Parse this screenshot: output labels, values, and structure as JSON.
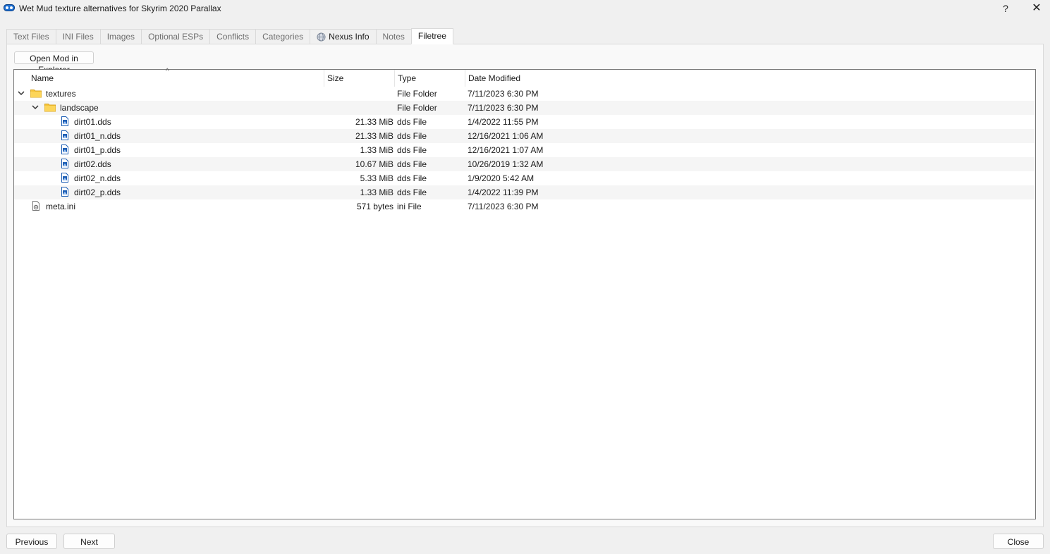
{
  "window": {
    "title": "Wet Mud texture alternatives for Skyrim 2020 Parallax",
    "help_label": "?",
    "close_label": "✕"
  },
  "tabs": [
    {
      "label": "Text Files",
      "active": false
    },
    {
      "label": "INI Files",
      "active": false
    },
    {
      "label": "Images",
      "active": false
    },
    {
      "label": "Optional ESPs",
      "active": false
    },
    {
      "label": "Conflicts",
      "active": false
    },
    {
      "label": "Categories",
      "active": false
    },
    {
      "label": "Nexus Info",
      "active": false,
      "icon": "globe-icon"
    },
    {
      "label": "Notes",
      "active": false
    },
    {
      "label": "Filetree",
      "active": true
    }
  ],
  "toolbar": {
    "open_mod_label": "Open Mod in Explorer"
  },
  "tree": {
    "columns": [
      "Name",
      "Size",
      "Type",
      "Date Modified"
    ],
    "sort_indicator": "^",
    "rows": [
      {
        "name": "textures",
        "size": "",
        "type": "File Folder",
        "date": "7/11/2023 6:30 PM",
        "icon": "folder-icon",
        "expanded": true
      },
      {
        "name": "landscape",
        "size": "",
        "type": "File Folder",
        "date": "7/11/2023 6:30 PM",
        "icon": "folder-icon",
        "expanded": true
      },
      {
        "name": "dirt01.dds",
        "size": "21.33 MiB",
        "type": "dds File",
        "date": "1/4/2022 11:55 PM",
        "icon": "image-file-icon"
      },
      {
        "name": "dirt01_n.dds",
        "size": "21.33 MiB",
        "type": "dds File",
        "date": "12/16/2021 1:06 AM",
        "icon": "image-file-icon"
      },
      {
        "name": "dirt01_p.dds",
        "size": "1.33 MiB",
        "type": "dds File",
        "date": "12/16/2021 1:07 AM",
        "icon": "image-file-icon"
      },
      {
        "name": "dirt02.dds",
        "size": "10.67 MiB",
        "type": "dds File",
        "date": "10/26/2019 1:32 AM",
        "icon": "image-file-icon"
      },
      {
        "name": "dirt02_n.dds",
        "size": "5.33 MiB",
        "type": "dds File",
        "date": "1/9/2020 5:42 AM",
        "icon": "image-file-icon"
      },
      {
        "name": "dirt02_p.dds",
        "size": "1.33 MiB",
        "type": "dds File",
        "date": "1/4/2022 11:39 PM",
        "icon": "image-file-icon"
      },
      {
        "name": "meta.ini",
        "size": "571 bytes",
        "type": "ini File",
        "date": "7/11/2023 6:30 PM",
        "icon": "settings-file-icon"
      }
    ]
  },
  "footer": {
    "previous_label": "Previous",
    "next_label": "Next",
    "close_label": "Close"
  }
}
